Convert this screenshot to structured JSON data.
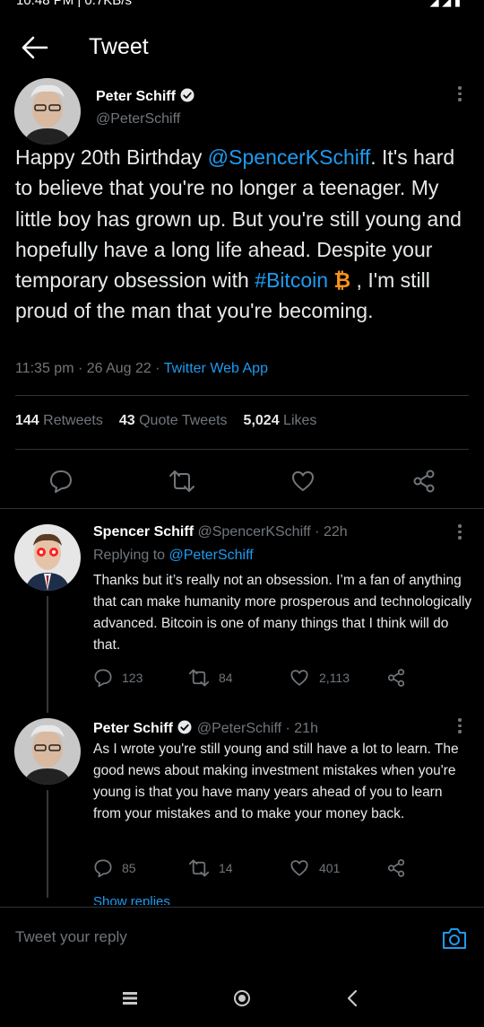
{
  "status_bar": {
    "time_text": "10:48 PM | 0.7KB/s"
  },
  "header": {
    "title": "Tweet"
  },
  "main_tweet": {
    "author_name": "Peter Schiff",
    "author_handle": "@PeterSchiff",
    "text_part1": "Happy 20th Birthday ",
    "mention": "@SpencerKSchiff",
    "text_part2": ". It's hard to believe that you're no longer a teenager. My little boy has grown up. But you're still young and hopefully have a long life ahead. Despite your temporary obsession with ",
    "hashtag": "#Bitcoin",
    "text_part3": " , I'm still proud of the man that you're becoming.",
    "time": "11:35 pm",
    "date": "26 Aug 22",
    "source": "Twitter Web App",
    "retweets_count": "144",
    "retweets_label": "Retweets",
    "quote_count": "43",
    "quote_label": "Quote Tweets",
    "likes_count": "5,024",
    "likes_label": "Likes"
  },
  "replies": [
    {
      "author_name": "Spencer Schiff",
      "author_handle": "@SpencerKSchiff",
      "age": "22h",
      "replying_label": "Replying to",
      "replying_to": "@PeterSchiff",
      "text": "Thanks but it’s really not an obsession. I’m a fan of anything that can make humanity more prosperous and technologically advanced. Bitcoin is one of many things that I think will do that.",
      "reply_count": "123",
      "retweet_count": "84",
      "like_count": "2,113"
    },
    {
      "author_name": "Peter Schiff",
      "author_handle": "@PeterSchiff",
      "age": "21h",
      "text": "As I wrote you're still young and still have a lot to learn.  The good news about making investment mistakes when you're young is that you have many years ahead of you to learn from your mistakes and to make your money back.",
      "reply_count": "85",
      "retweet_count": "14",
      "like_count": "401"
    }
  ],
  "show_replies_label": "Show replies",
  "composer": {
    "placeholder": "Tweet your reply"
  },
  "colors": {
    "accent": "#1d9bf0",
    "muted": "#71767b",
    "bitcoin": "#f7931a"
  }
}
